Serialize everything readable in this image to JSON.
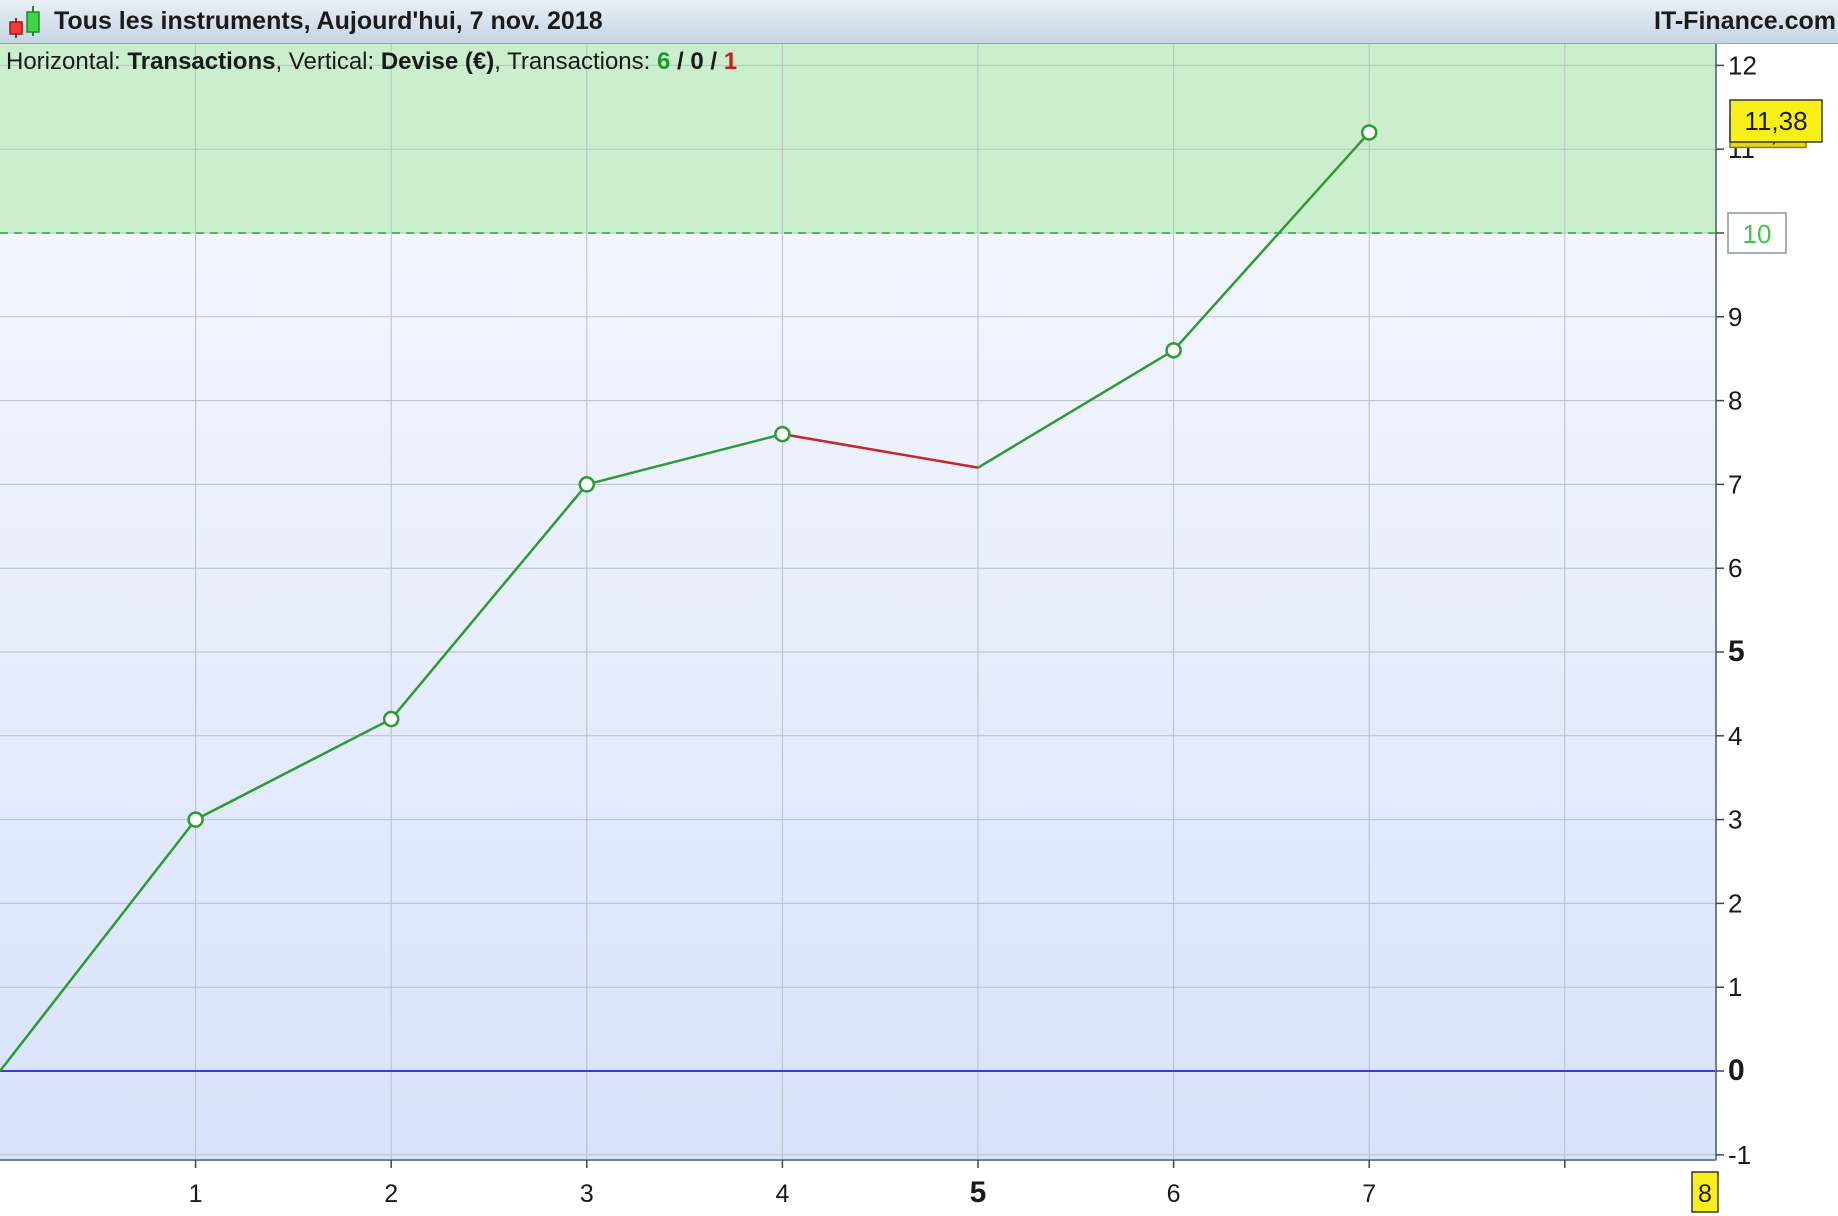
{
  "window": {
    "title": "Tous les instruments, Aujourd'hui, 7 nov. 2018",
    "brand": "IT-Finance.com"
  },
  "legend": {
    "horizontal_label": "Horizontal:",
    "horizontal_value": "Transactions",
    "vertical_label": ", Vertical:",
    "vertical_value": "Devise (€)",
    "transactions_label": ", Transactions:",
    "wins": "6",
    "sep1": " / ",
    "neutral": "0",
    "sep2": " / ",
    "losses": "1"
  },
  "chart_data": {
    "type": "line",
    "x": [
      0,
      1,
      2,
      3,
      4,
      5,
      6,
      7
    ],
    "y": [
      0,
      3.0,
      4.2,
      7.0,
      7.6,
      7.2,
      8.6,
      11.2
    ],
    "xlim": [
      0,
      8.8
    ],
    "ylim": [
      -1.1,
      12.4
    ],
    "x_ticks": [
      "1",
      "2",
      "3",
      "4",
      "5",
      "6",
      "7",
      "8"
    ],
    "y_ticks": [
      "-1",
      "0",
      "1",
      "2",
      "3",
      "4",
      "5",
      "6",
      "7",
      "8",
      "9",
      "10",
      "11",
      "12"
    ],
    "threshold": 10,
    "threshold_label": "10",
    "current_value_label": "11,38",
    "last_point_label": "11,2",
    "current_x_label": "8",
    "grid": true,
    "colors": {
      "gain": "#2e9a32",
      "loss": "#c62828",
      "zero_line": "#3a3ad6",
      "profit_zone": "#cbeecd",
      "bg_top": "#f8f9fe",
      "bg_bottom": "#d7e3fb",
      "grid": "#b6c0cc",
      "badge": "#f7ee1a"
    }
  }
}
